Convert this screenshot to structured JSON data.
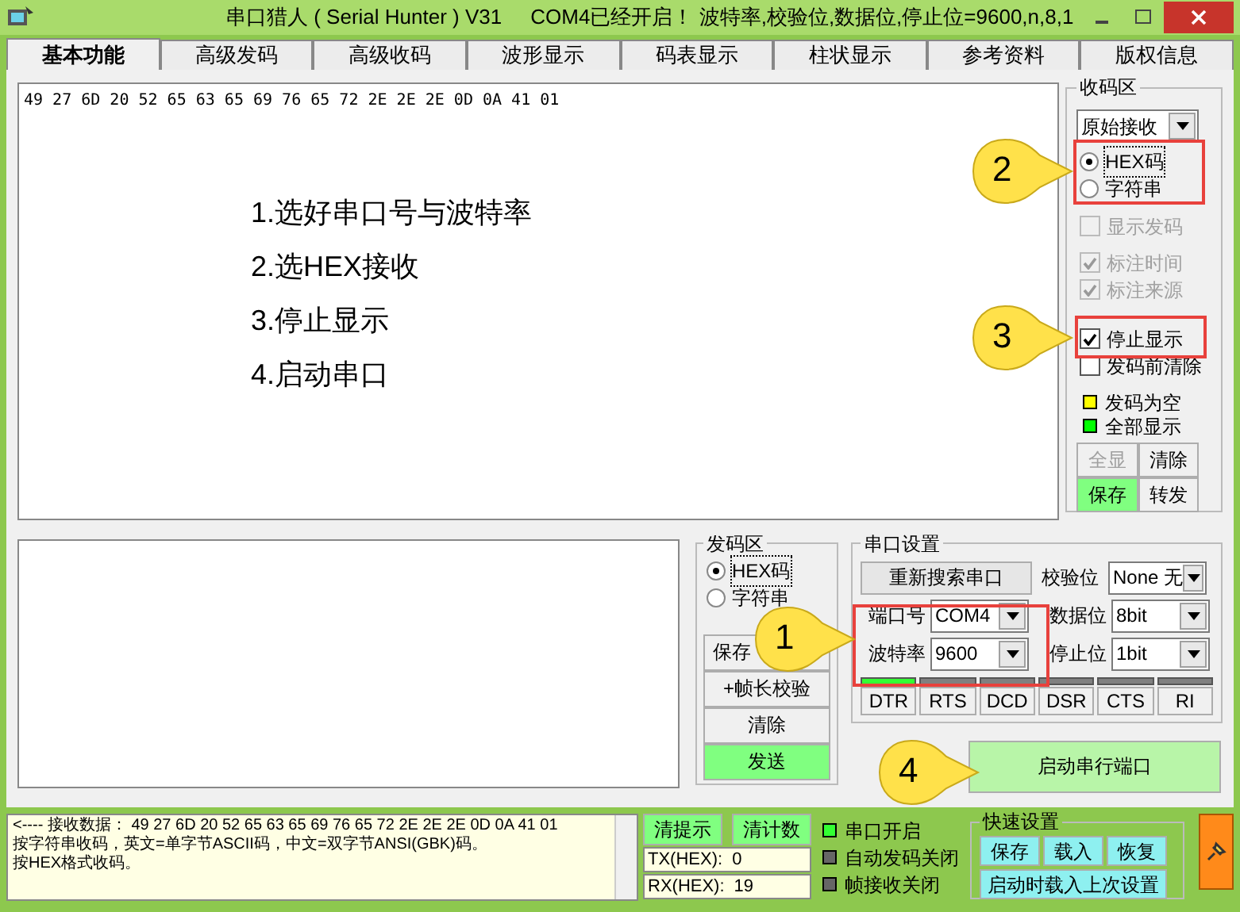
{
  "window": {
    "title": "串口猎人 ( Serial Hunter ) V31     COM4已经开启！ 波特率,校验位,数据位,停止位=9600,n,8,1"
  },
  "tabs": [
    {
      "label": "基本功能",
      "selected": true
    },
    {
      "label": "高级发码",
      "selected": false
    },
    {
      "label": "高级收码",
      "selected": false
    },
    {
      "label": "波形显示",
      "selected": false
    },
    {
      "label": "码表显示",
      "selected": false
    },
    {
      "label": "柱状显示",
      "selected": false
    },
    {
      "label": "参考资料",
      "selected": false
    },
    {
      "label": "版权信息",
      "selected": false
    }
  ],
  "receive": {
    "text": "49 27 6D 20 52 65 63 65 69 76 65 72 2E 2E 2E 0D 0A 41 01",
    "instructions": [
      "1.选好串口号与波特率",
      "2.选HEX接收",
      "3.停止显示",
      "4.启动串口"
    ]
  },
  "receive_panel": {
    "title": "收码区",
    "mode": "原始接收",
    "formats": [
      {
        "label": "HEX码",
        "selected": true
      },
      {
        "label": "字符串",
        "selected": false
      }
    ],
    "options": [
      {
        "label": "显示发码",
        "checked": false,
        "disabled": true
      },
      {
        "label": "标注时间",
        "checked": true,
        "disabled": true
      },
      {
        "label": "标注来源",
        "checked": true,
        "disabled": true
      },
      {
        "label": "停止显示",
        "checked": true,
        "disabled": false
      },
      {
        "label": "发码前清除",
        "checked": false,
        "disabled": false
      }
    ],
    "legend": [
      {
        "label": "发码为空",
        "color": "#ffff00"
      },
      {
        "label": "全部显示",
        "color": "#00ff00"
      }
    ],
    "buttons": [
      {
        "label": "全显",
        "disabled": true,
        "highlighted": false
      },
      {
        "label": "清除",
        "disabled": false,
        "highlighted": false
      },
      {
        "label": "保存",
        "disabled": false,
        "highlighted": true
      },
      {
        "label": "转发",
        "disabled": false,
        "highlighted": false
      }
    ]
  },
  "send_panel": {
    "title": "发码区",
    "formats": [
      {
        "label": "HEX码",
        "selected": true
      },
      {
        "label": "字符串",
        "selected": false
      }
    ],
    "buttons": [
      {
        "label": "保存",
        "highlighted": false
      },
      {
        "label": "+帧长校验",
        "highlighted": false
      },
      {
        "label": "清除",
        "highlighted": false
      },
      {
        "label": "发送",
        "highlighted": true
      }
    ]
  },
  "port_settings": {
    "title": "串口设置",
    "rescan": "重新搜索串口",
    "fields": [
      {
        "label": "端口号",
        "value": "COM4"
      },
      {
        "label": "波特率",
        "value": "9600"
      },
      {
        "label": "校验位",
        "value": "None 无"
      },
      {
        "label": "数据位",
        "value": "8bit"
      },
      {
        "label": "停止位",
        "value": "1bit"
      }
    ],
    "signals": [
      {
        "label": "DTR",
        "on": true
      },
      {
        "label": "RTS",
        "on": false
      },
      {
        "label": "DCD",
        "on": false
      },
      {
        "label": "DSR",
        "on": false
      },
      {
        "label": "CTS",
        "on": false
      },
      {
        "label": "RI",
        "on": false
      }
    ]
  },
  "start_button": "启动串行端口",
  "callouts": [
    "1",
    "2",
    "3",
    "4"
  ],
  "status": {
    "log": [
      "<---- 接收数据： 49 27 6D 20 52 65 63 65 69 76 65 72 2E 2E 2E 0D 0A 41 01",
      "按字符串收码，英文=单字节ASCII码，中文=双字节ANSI(GBK)码。",
      "按HEX格式收码。"
    ],
    "buttons": [
      "清提示",
      "清计数"
    ],
    "counters": [
      {
        "label": "TX(HEX):",
        "value": "0"
      },
      {
        "label": "RX(HEX):",
        "value": "19"
      }
    ],
    "indicators": [
      {
        "label": "串口开启",
        "on": true
      },
      {
        "label": "自动发码关闭",
        "on": false
      },
      {
        "label": "帧接收关闭",
        "on": false
      }
    ],
    "quick": {
      "title": "快速设置",
      "buttons": [
        "保存",
        "载入",
        "恢复"
      ],
      "wide_button": "启动时载入上次设置"
    }
  }
}
